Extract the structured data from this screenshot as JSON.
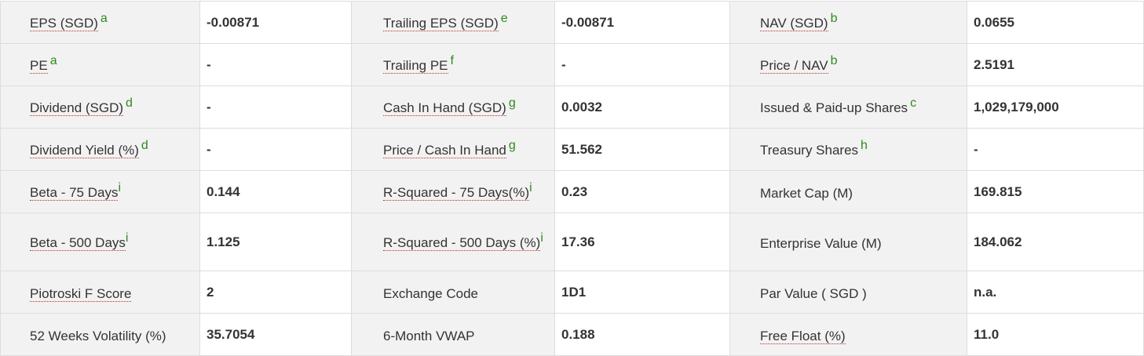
{
  "rows": [
    {
      "c1": {
        "text": "EPS (SGD)",
        "sup": "a",
        "u": true
      },
      "v1": "-0.00871",
      "c2": {
        "text": "Trailing EPS (SGD)",
        "sup": "e",
        "u": true
      },
      "v2": "-0.00871",
      "c3": {
        "text": "NAV (SGD)",
        "sup": "b",
        "u": true
      },
      "v3": "0.0655"
    },
    {
      "c1": {
        "text": "PE",
        "sup": "a",
        "u": true
      },
      "v1": "-",
      "c2": {
        "text": "Trailing PE",
        "sup": "f",
        "u": true
      },
      "v2": "-",
      "c3": {
        "text": "Price / NAV",
        "sup": "b",
        "u": true
      },
      "v3": "2.5191"
    },
    {
      "c1": {
        "text": "Dividend (SGD)",
        "sup": "d",
        "u": true
      },
      "v1": "-",
      "c2": {
        "text": "Cash In Hand (SGD)",
        "sup": "g",
        "u": true
      },
      "v2": "0.0032",
      "c3": {
        "text": "Issued & Paid-up Shares",
        "sup": "c",
        "u": false
      },
      "v3": "1,029,179,000"
    },
    {
      "c1": {
        "text": "Dividend Yield (%)",
        "sup": "d",
        "u": true
      },
      "v1": "-",
      "c2": {
        "text": "Price / Cash In Hand",
        "sup": "g",
        "u": true
      },
      "v2": "51.562",
      "c3": {
        "text": "Treasury Shares",
        "sup": "h",
        "u": false
      },
      "v3": "-"
    },
    {
      "c1": {
        "text": "Beta - 75 Days",
        "sup": "i",
        "u": true
      },
      "v1": "0.144",
      "c2": {
        "text": "R-Squared - 75 Days(%)",
        "sup": "i",
        "u": true
      },
      "v2": "0.23",
      "c3": {
        "text": "Market Cap (M)",
        "sup": "",
        "u": false
      },
      "v3": "169.815"
    },
    {
      "c1": {
        "text": "Beta - 500 Days",
        "sup": "i",
        "u": true
      },
      "v1": "1.125",
      "c2": {
        "text": "R-Squared - 500 Days (%)",
        "sup": "i",
        "u": true
      },
      "v2": "17.36",
      "c3": {
        "text": "Enterprise Value (M)",
        "sup": "",
        "u": false
      },
      "v3": "184.062"
    },
    {
      "c1": {
        "text": "Piotroski F Score",
        "sup": "",
        "u": true
      },
      "v1": "2",
      "c2": {
        "text": "Exchange Code",
        "sup": "",
        "u": false
      },
      "v2": "1D1",
      "c3": {
        "text": "Par Value ( SGD )",
        "sup": "",
        "u": false
      },
      "v3": "n.a."
    },
    {
      "c1": {
        "text": "52 Weeks Volatility (%)",
        "sup": "",
        "u": false
      },
      "v1": "35.7054",
      "c2": {
        "text": "6-Month VWAP",
        "sup": "",
        "u": false
      },
      "v2": "0.188",
      "c3": {
        "text": "Free Float (%)",
        "sup": "",
        "u": true
      },
      "v3": "11.0"
    }
  ]
}
